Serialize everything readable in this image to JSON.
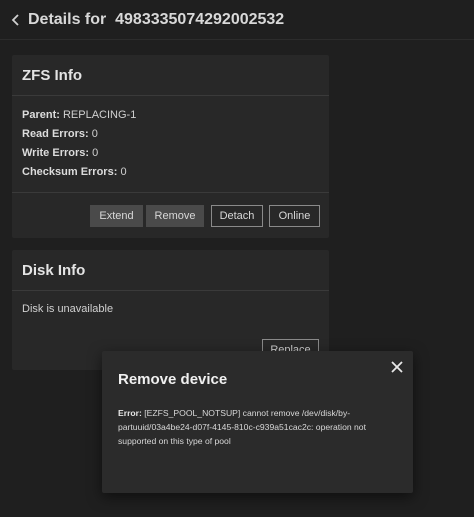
{
  "header": {
    "title": "Details for  4983335074292002532"
  },
  "zfs_info": {
    "title": "ZFS Info",
    "rows": [
      {
        "label": "Parent:",
        "value": "REPLACING-1"
      },
      {
        "label": "Read Errors:",
        "value": "0"
      },
      {
        "label": "Write Errors:",
        "value": "0"
      },
      {
        "label": "Checksum Errors:",
        "value": "0"
      }
    ],
    "buttons": {
      "extend": "Extend",
      "remove": "Remove",
      "detach": "Detach",
      "online": "Online"
    }
  },
  "disk_info": {
    "title": "Disk Info",
    "message": "Disk is unavailable",
    "replace": "Replace"
  },
  "dialog": {
    "title": "Remove device",
    "error_label": "Error:",
    "error_message": " [EZFS_POOL_NOTSUP] cannot remove /dev/disk/by-partuuid/03a4be24-d07f-4145-810c-c939a51cac2c: operation not supported on this type of pool"
  },
  "colors": {
    "background": "#1f1f1f",
    "card": "#282828",
    "dialog": "#2b2b2b",
    "button_filled": "#4a4a4a"
  },
  "icons": {
    "back": "chevron-left-icon",
    "close": "close-icon"
  }
}
